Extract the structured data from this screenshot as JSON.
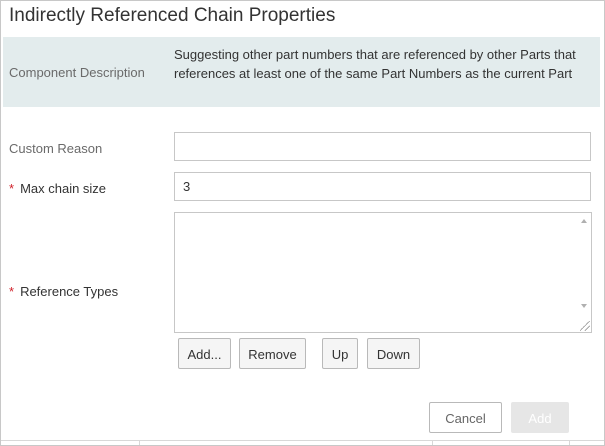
{
  "dialog": {
    "title": "Indirectly Referenced Chain Properties"
  },
  "description": {
    "label": "Component Description",
    "text": "Suggesting other part numbers that are referenced by other Parts that references at least one of the same Part Numbers as the current Part"
  },
  "fields": {
    "custom_reason": {
      "label": "Custom Reason",
      "value": ""
    },
    "max_chain_size": {
      "required_mark": "*",
      "label": "Max chain size",
      "value": "3"
    },
    "reference_types": {
      "required_mark": "*",
      "label": "Reference Types",
      "value": ""
    }
  },
  "list_buttons": {
    "add": "Add...",
    "remove": "Remove",
    "up": "Up",
    "down": "Down"
  },
  "footer": {
    "cancel": "Cancel",
    "add": "Add"
  },
  "colors": {
    "description_band": "#e3eced",
    "required_mark": "#d0202a",
    "disabled_button": "#e6e6e6"
  }
}
